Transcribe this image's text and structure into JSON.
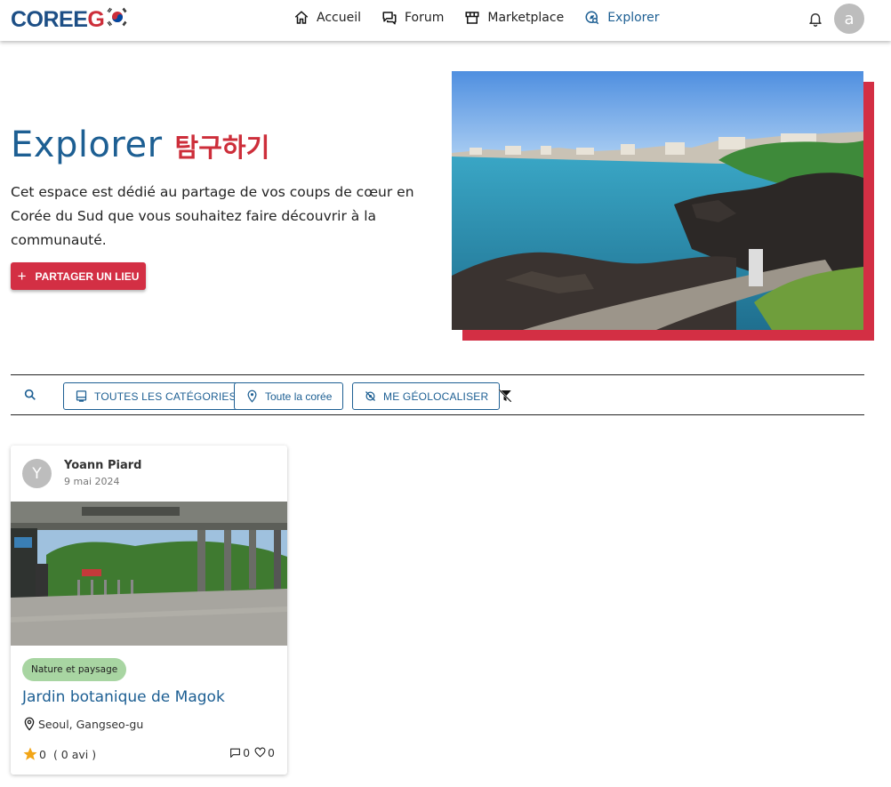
{
  "header": {
    "logo_text_a": "COREE",
    "logo_text_b": "G",
    "nav": [
      {
        "label": "Accueil",
        "icon": "home-icon"
      },
      {
        "label": "Forum",
        "icon": "forum-icon"
      },
      {
        "label": "Marketplace",
        "icon": "store-icon"
      },
      {
        "label": "Explorer",
        "icon": "explore-icon",
        "active": true
      }
    ],
    "avatar_initial": "a",
    "accent_color": "#1d5f93",
    "brand_red": "#cd2e3a"
  },
  "hero": {
    "title": "Explorer",
    "title_korean": "탐구하기",
    "description": "Cet espace est dédié au partage de vos coups de cœur en Corée du Sud que vous souhaitez faire découvrir à la communauté.",
    "share_button": "PARTAGER UN LIEU"
  },
  "filters": {
    "categories_label": "TOUTES LES CATÉGORIES",
    "region_label": "Toute la corée",
    "geolocate_label": "ME GÉOLOCALISER"
  },
  "cards": [
    {
      "author_initial": "Y",
      "author": "Yoann Piard",
      "date": "9 mai 2024",
      "category": "Nature et paysage",
      "title": "Jardin botanique de Magok",
      "location": "Seoul, Gangseo-gu",
      "rating": "0",
      "reviews": "( 0 avi )",
      "comments": "0",
      "likes": "0"
    }
  ]
}
